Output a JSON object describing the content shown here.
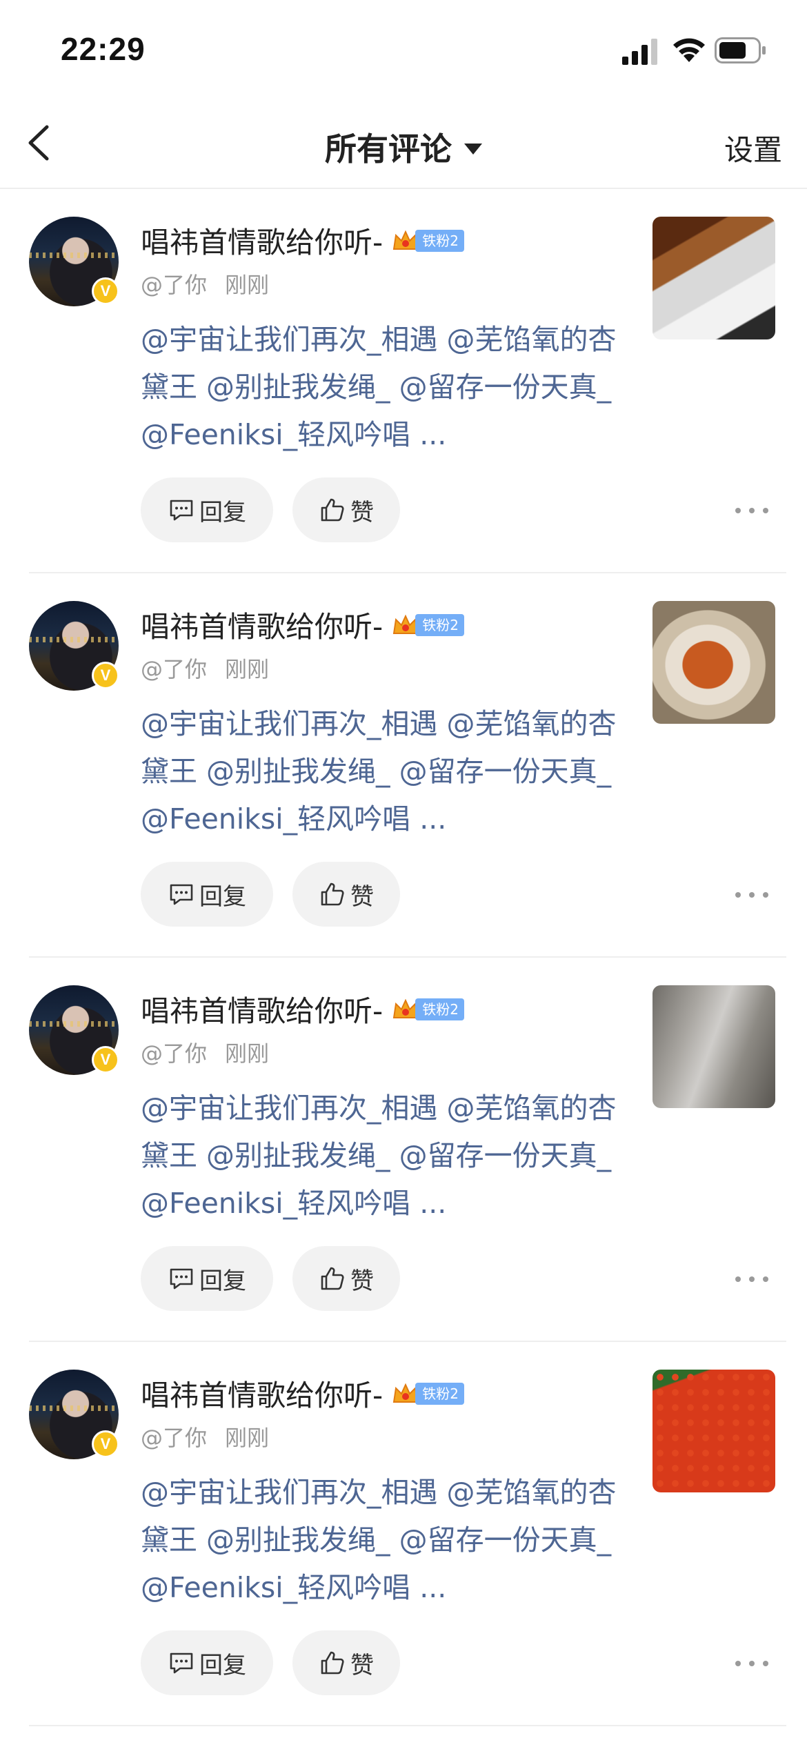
{
  "status_bar": {
    "time": "22:29"
  },
  "nav": {
    "title": "所有评论",
    "settings_label": "设置"
  },
  "colors": {
    "link_text": "#4e6693",
    "verified_badge": "#f7c21b",
    "fan_badge": "#74aef7",
    "pill_background": "#f2f2f2"
  },
  "comments": [
    {
      "username": "唱祎首情歌给你听-",
      "fan_badge": "铁粉2",
      "mention_label": "@了你",
      "timestamp": "刚刚",
      "text": "@宇宙让我们再次_相遇 @芜馅氧的杏黛王 @别扯我发绳_ @留存一份天真_ @Feeniksi_轻风吟唱 ...",
      "reply_label": "回复",
      "like_label": "赞",
      "thumbnail": "food-photo"
    },
    {
      "username": "唱祎首情歌给你听-",
      "fan_badge": "铁粉2",
      "mention_label": "@了你",
      "timestamp": "刚刚",
      "text": "@宇宙让我们再次_相遇 @芜馅氧的杏黛王 @别扯我发绳_ @留存一份天真_ @Feeniksi_轻风吟唱 ...",
      "reply_label": "回复",
      "like_label": "赞",
      "thumbnail": "noodle-bowl-photo"
    },
    {
      "username": "唱祎首情歌给你听-",
      "fan_badge": "铁粉2",
      "mention_label": "@了你",
      "timestamp": "刚刚",
      "text": "@宇宙让我们再次_相遇 @芜馅氧的杏黛王 @别扯我发绳_ @留存一份天真_ @Feeniksi_轻风吟唱 ...",
      "reply_label": "回复",
      "like_label": "赞",
      "thumbnail": "package-photo"
    },
    {
      "username": "唱祎首情歌给你听-",
      "fan_badge": "铁粉2",
      "mention_label": "@了你",
      "timestamp": "刚刚",
      "text": "@宇宙让我们再次_相遇 @芜馅氧的杏黛王 @别扯我发绳_ @留存一份天真_ @Feeniksi_轻风吟唱 ...",
      "reply_label": "回复",
      "like_label": "赞",
      "thumbnail": "berries-photo"
    }
  ]
}
